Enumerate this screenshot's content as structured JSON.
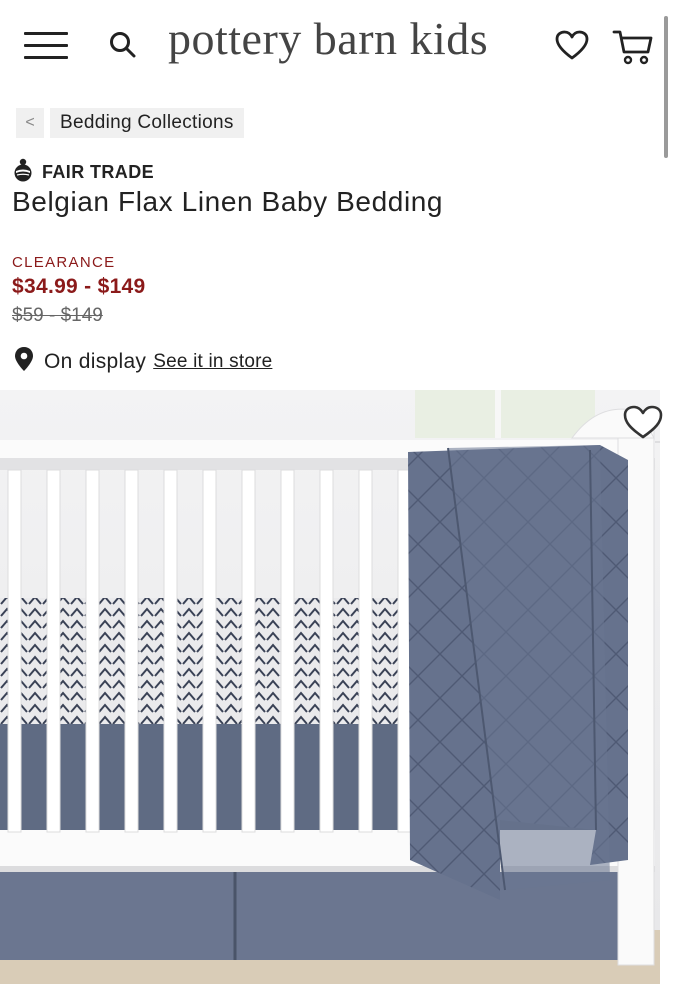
{
  "header": {
    "logo": "pottery barn kids",
    "menu_icon": "hamburger-menu-icon",
    "search_icon": "search-icon",
    "wishlist_icon": "heart-icon",
    "cart_icon": "shopping-cart-icon"
  },
  "breadcrumb": {
    "back_label": "<",
    "link_label": "Bedding Collections"
  },
  "product": {
    "badge_icon": "fair-trade-icon",
    "badge_label": "FAIR TRADE",
    "title": "Belgian Flax Linen Baby Bedding",
    "sale_tag": "CLEARANCE",
    "sale_price": "$34.99 - $149",
    "original_price": "$59 - $149",
    "availability_icon": "location-pin-icon",
    "availability_text": "On display",
    "store_link": "See it in store",
    "image_favorite_icon": "heart-outline-icon"
  },
  "colors": {
    "clearance_red": "#8b1a1a",
    "text": "#222222",
    "linen_blue": "#5d6a85"
  }
}
